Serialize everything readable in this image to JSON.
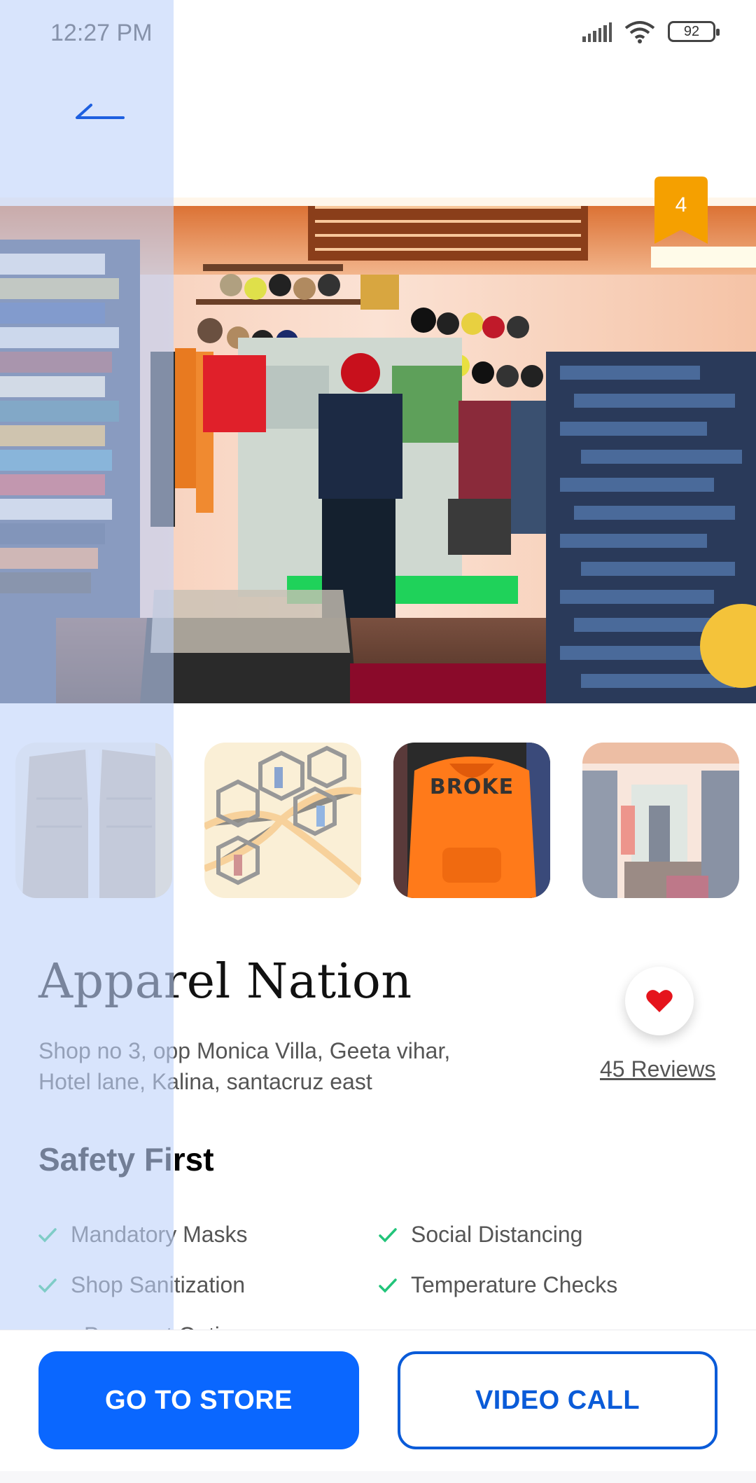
{
  "status_bar": {
    "time": "12:27 PM",
    "battery": "92",
    "icons": [
      "signal-icon",
      "wifi-icon",
      "battery-icon"
    ]
  },
  "header": {
    "back_icon": "back-arrow-icon"
  },
  "hero": {
    "image": "store-interior-photo",
    "badge": "4"
  },
  "thumbnails": [
    {
      "image": "jacket-photo",
      "state": "faded"
    },
    {
      "image": "perfume-shelf-photo",
      "state": "faded"
    },
    {
      "image": "orange-hoodie-photo",
      "state": "active",
      "text": "BROKE"
    },
    {
      "image": "store-interior-photo",
      "state": "faded"
    }
  ],
  "store": {
    "name": "Apparel Nation",
    "address": " Shop no 3, opp Monica Villa, Geeta vihar, Hotel lane, Kalina, santacruz east",
    "reviews": "45 Reviews",
    "favorite_icon": "heart-icon"
  },
  "safety": {
    "title": "Safety First",
    "items": [
      "Mandatory Masks",
      "Social Distancing",
      "Shop Sanitization",
      "Temperature Checks"
    ],
    "partial_item": "Payment Options"
  },
  "actions": {
    "primary": "GO TO STORE",
    "secondary": "VIDEO CALL"
  },
  "colors": {
    "accent": "#0a67ff",
    "badge": "#f5a000",
    "heart": "#e5141c",
    "check": "#22c47a"
  }
}
